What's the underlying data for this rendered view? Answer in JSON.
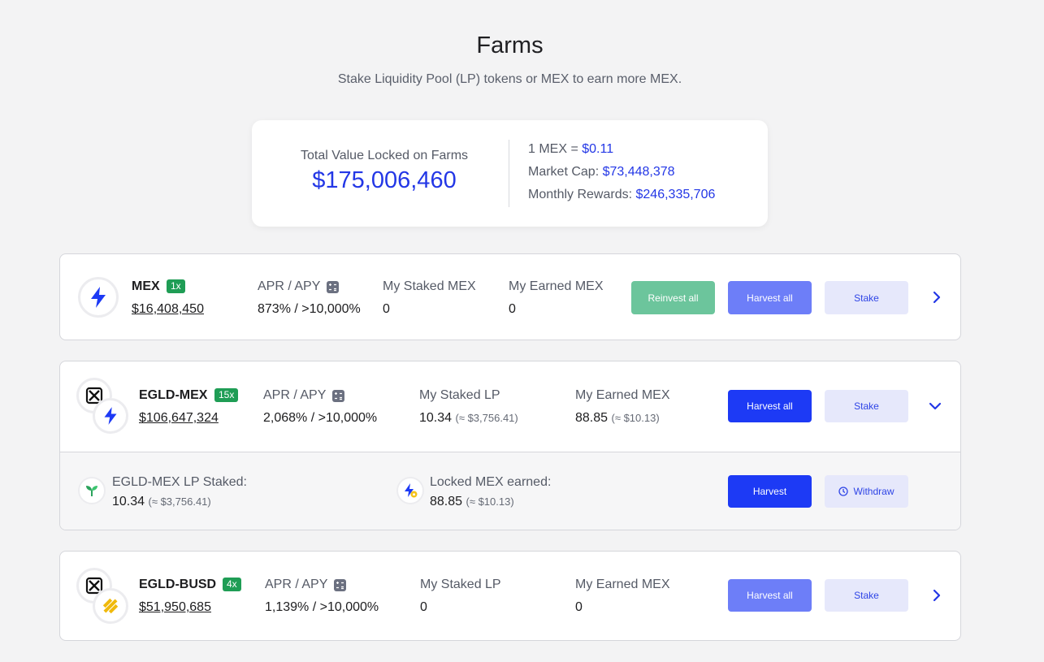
{
  "header": {
    "title": "Farms",
    "subtitle": "Stake Liquidity Pool (LP) tokens or MEX to earn more MEX."
  },
  "summary": {
    "tvl_label": "Total Value Locked on Farms",
    "tvl_value": "$175,006,460",
    "price_label": "1 MEX = ",
    "price_value": "$0.11",
    "market_cap_label": "Market Cap: ",
    "market_cap_value": "$73,448,378",
    "monthly_rewards_label": "Monthly Rewards: ",
    "monthly_rewards_value": "$246,335,706"
  },
  "farms": [
    {
      "name": "MEX",
      "multiplier": "1x",
      "usd": "$16,408,450",
      "apr_label": "APR / APY",
      "apr_value": "873% / >10,000%",
      "staked_label": "My Staked MEX",
      "staked_value": "0",
      "earned_label": "My Earned MEX",
      "earned_value": "0",
      "reinvest_label": "Reinvest all",
      "harvest_label": "Harvest all",
      "stake_label": "Stake"
    },
    {
      "name": "EGLD-MEX",
      "multiplier": "15x",
      "usd": "$106,647,324",
      "apr_label": "APR / APY",
      "apr_value": "2,068% / >10,000%",
      "staked_label": "My Staked LP",
      "staked_value": "10.34",
      "staked_approx": "(≈ $3,756.41)",
      "earned_label": "My Earned MEX",
      "earned_value": "88.85",
      "earned_approx": "(≈ $10.13)",
      "harvest_label": "Harvest all",
      "stake_label": "Stake",
      "detail": {
        "lp_label": "EGLD-MEX LP Staked:",
        "lp_value": "10.34",
        "lp_approx": "(≈ $3,756.41)",
        "locked_label": "Locked MEX earned:",
        "locked_value": "88.85",
        "locked_approx": "(≈ $10.13)",
        "harvest_label": "Harvest",
        "withdraw_label": "Withdraw"
      }
    },
    {
      "name": "EGLD-BUSD",
      "multiplier": "4x",
      "usd": "$51,950,685",
      "apr_label": "APR / APY",
      "apr_value": "1,139% / >10,000%",
      "staked_label": "My Staked LP",
      "staked_value": "0",
      "earned_label": "My Earned MEX",
      "earned_value": "0",
      "harvest_label": "Harvest all",
      "stake_label": "Stake"
    }
  ],
  "icons": {
    "mex": "lightning-icon",
    "egld": "egld-icon",
    "busd": "busd-icon",
    "calculator": "calculator-icon",
    "lp": "sprout-icon",
    "locked": "locked-mex-icon",
    "clock": "clock-icon",
    "expand": "chevron-right-icon",
    "collapse": "chevron-down-icon"
  },
  "colors": {
    "accent": "#2337e6",
    "primary_button": "#1d3af5",
    "muted_button": "#6d7ef8",
    "reinvest_button": "#6cc59c",
    "stake_button": "#e6e8fb",
    "badge": "#1f9d55"
  }
}
